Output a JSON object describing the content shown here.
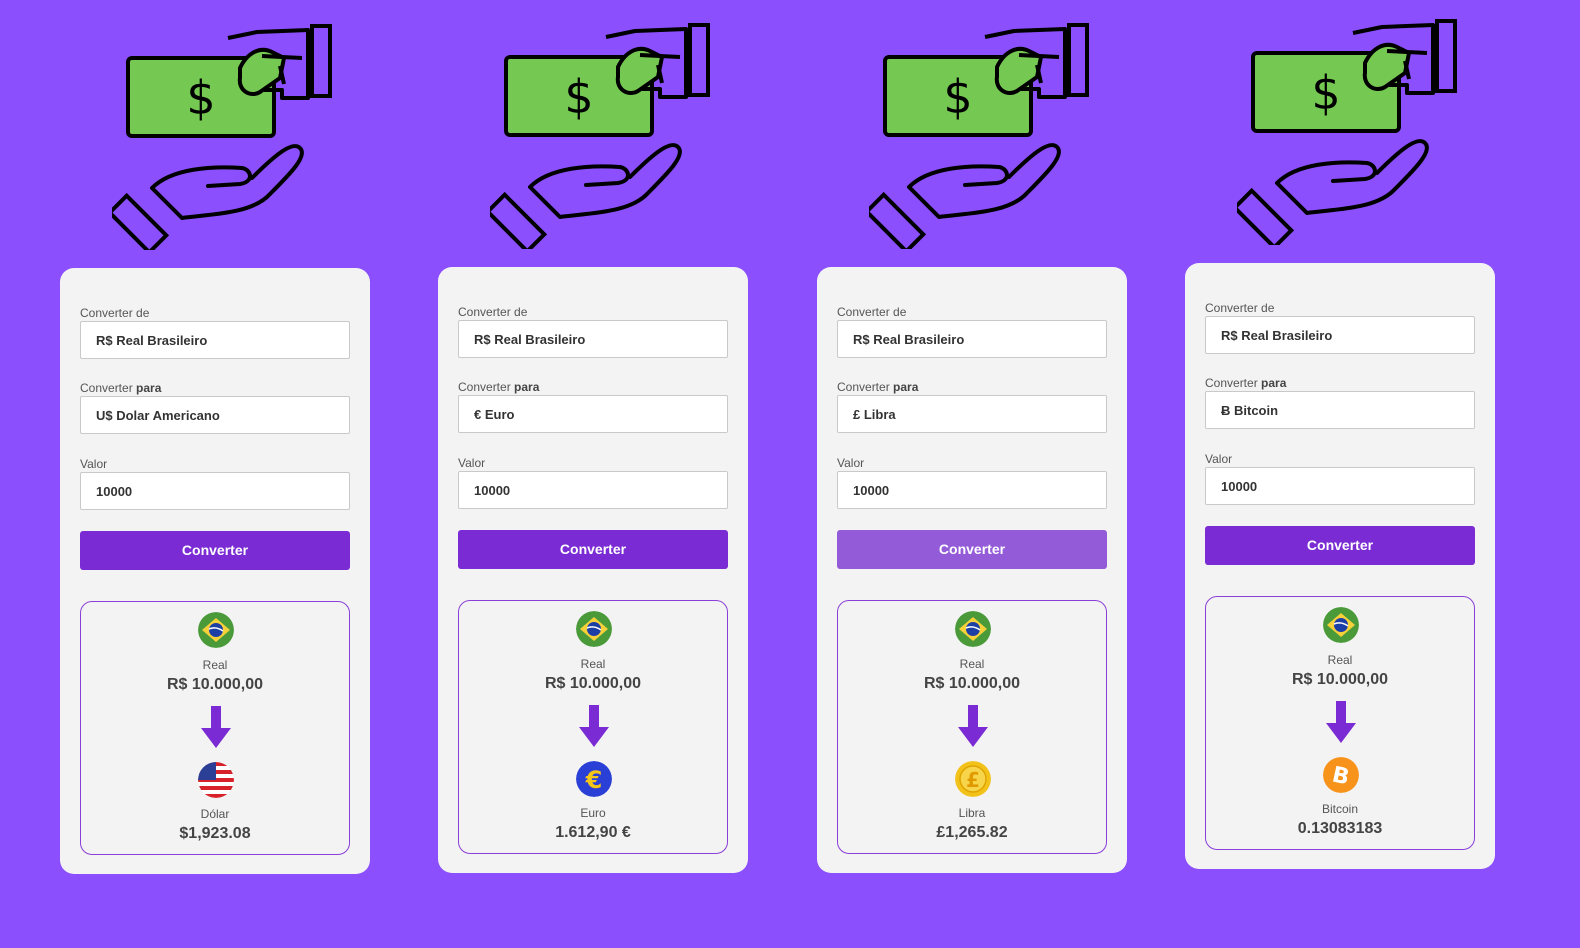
{
  "labels": {
    "from": "Converter de",
    "to_prefix": "Converter",
    "to_bold": "para",
    "value": "Valor",
    "button": "Converter"
  },
  "colors": {
    "background": "#8b4ffd",
    "accent": "#7a2bd4",
    "card": "#f3f3f3"
  },
  "cards": [
    {
      "from_currency": "R$ Real Brasileiro",
      "to_currency": "U$ Dolar Americano",
      "amount": "10000",
      "from_name": "Real",
      "from_value": "R$ 10.000,00",
      "to_name": "Dólar",
      "to_value": "$1,923.08",
      "to_icon": "us-flag-icon"
    },
    {
      "from_currency": "R$ Real Brasileiro",
      "to_currency": "€ Euro",
      "amount": "10000",
      "from_name": "Real",
      "from_value": "R$ 10.000,00",
      "to_name": "Euro",
      "to_value": "1.612,90 €",
      "to_icon": "euro-coin-icon"
    },
    {
      "from_currency": "R$ Real Brasileiro",
      "to_currency": "£ Libra",
      "amount": "10000",
      "from_name": "Real",
      "from_value": "R$ 10.000,00",
      "to_name": "Libra",
      "to_value": "£1,265.82",
      "to_icon": "pound-coin-icon"
    },
    {
      "from_currency": "R$ Real Brasileiro",
      "to_currency": "Ƀ Bitcoin",
      "amount": "10000",
      "from_name": "Real",
      "from_value": "R$ 10.000,00",
      "to_name": "Bitcoin",
      "to_value": "0.13083183",
      "to_icon": "bitcoin-icon"
    }
  ]
}
